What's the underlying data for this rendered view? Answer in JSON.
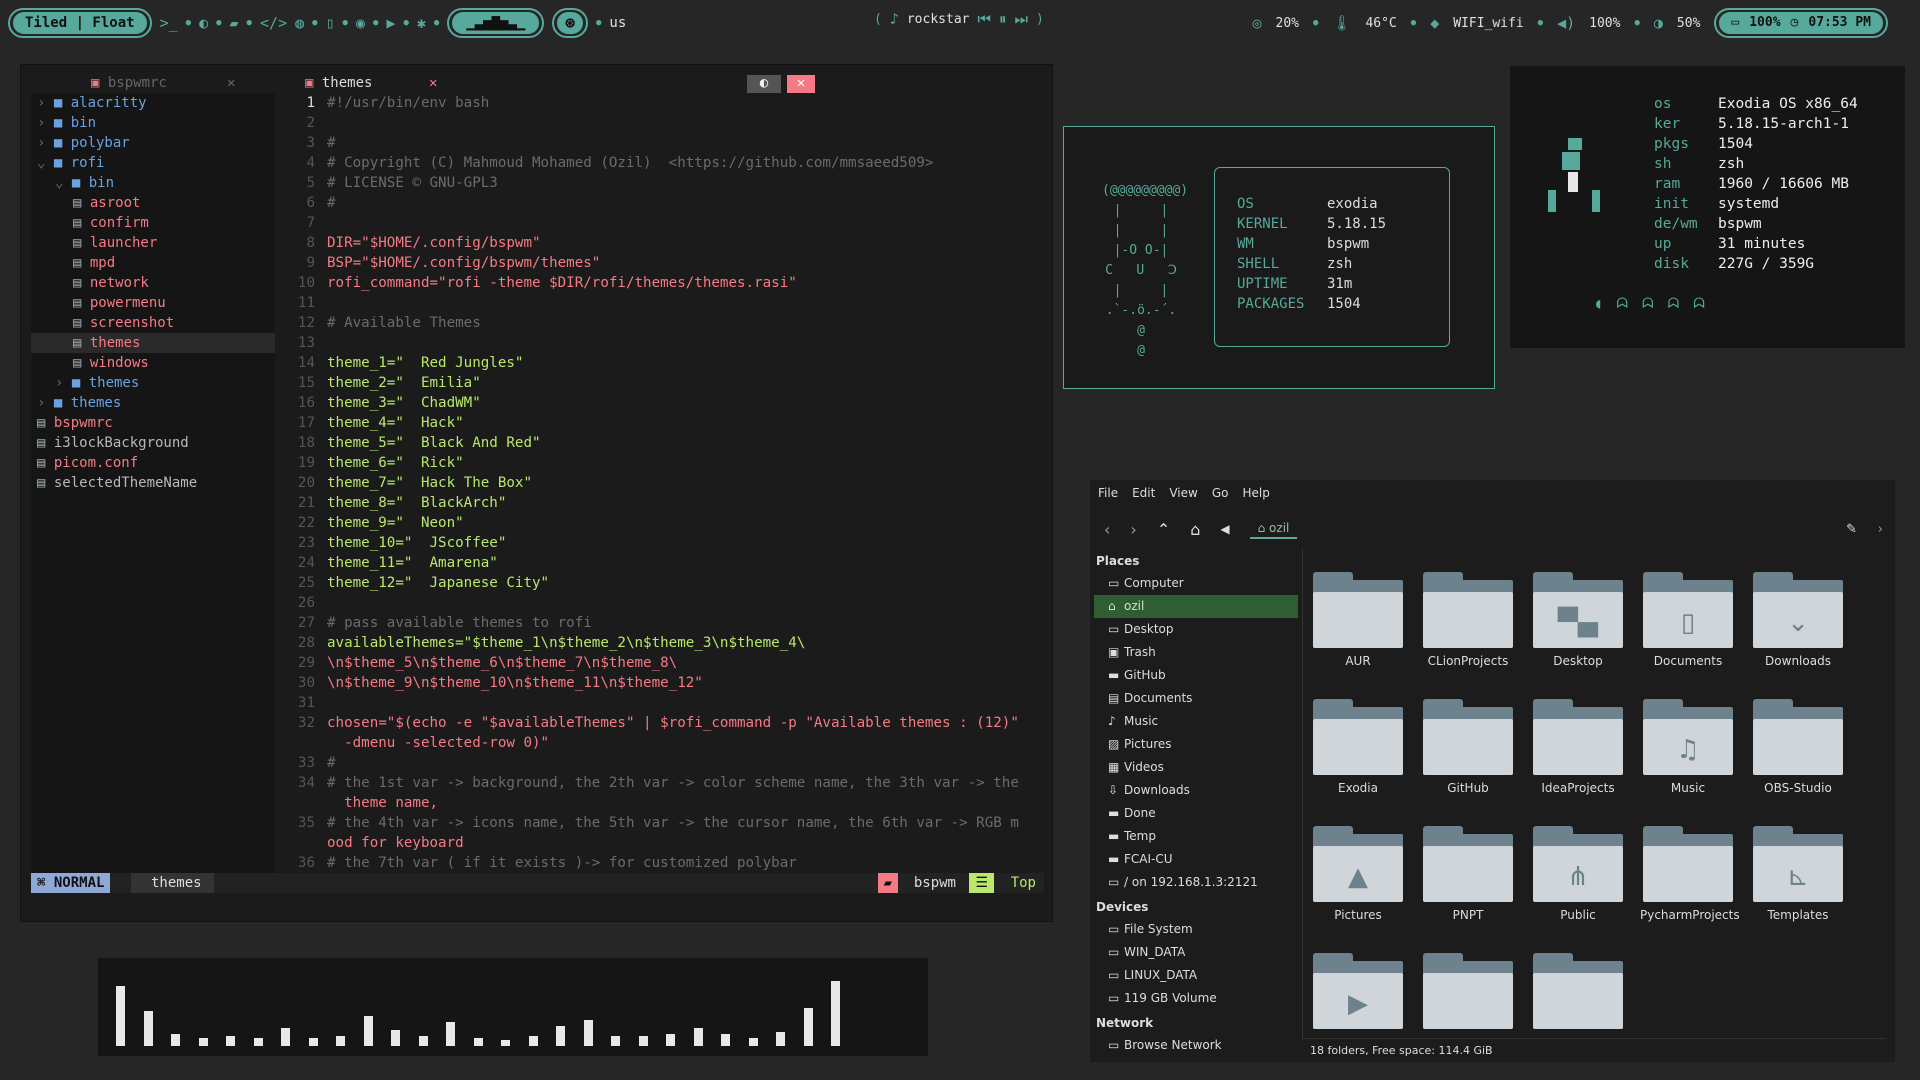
{
  "topbar": {
    "layout": "Tiled | Float",
    "keyboard": "us",
    "music": "rockstar",
    "cpu": "20%",
    "temp": "46°C",
    "wifi": "WIFI_wifi",
    "volume": "100%",
    "brightness": "50%",
    "battery": "100%",
    "time": "07:53 PM"
  },
  "colors": {
    "accent": "#57a99b",
    "bg": "#262626",
    "tab_close": "#f47b85"
  },
  "editor": {
    "tab_left": "bspwmrc",
    "tab_active": "themes",
    "tree": [
      "alacritty",
      "bin",
      "polybar",
      "rofi",
      "bin",
      "asroot",
      "confirm",
      "launcher",
      "mpd",
      "network",
      "powermenu",
      "screenshot",
      "themes",
      "windows",
      "themes",
      "themes",
      "bspwmrc",
      "i3lockBackground",
      "picom.conf",
      "selectedThemeName"
    ],
    "lines": [
      "#!/usr/bin/env bash",
      "",
      "#",
      "# Copyright (C) Mahmoud Mohamed (Ozil)  <https://github.com/mmsaeed509>",
      "# LICENSE © GNU-GPL3",
      "#",
      "",
      "DIR=\"$HOME/.config/bspwm\"",
      "BSP=\"$HOME/.config/bspwm/themes\"",
      "rofi_command=\"rofi -theme $DIR/rofi/themes/themes.rasi\"",
      "",
      "# Available Themes",
      "",
      "theme_1=\"  Red Jungles\"",
      "theme_2=\"  Emilia\"",
      "theme_3=\"  ChadWM\"",
      "theme_4=\"  Hack\"",
      "theme_5=\"  Black And Red\"",
      "theme_6=\"  Rick\"",
      "theme_7=\"  Hack The Box\"",
      "theme_8=\"  BlackArch\"",
      "theme_9=\"  Neon\"",
      "theme_10=\"  JScoffee\"",
      "theme_11=\"  Amarena\"",
      "theme_12=\"  Japanese City\"",
      "",
      "# pass available themes to rofi",
      "availableThemes=\"$theme_1\\n$theme_2\\n$theme_3\\n$theme_4\\",
      "\\n$theme_5\\n$theme_6\\n$theme_7\\n$theme_8\\",
      "\\n$theme_9\\n$theme_10\\n$theme_11\\n$theme_12\"",
      "",
      "chosen=\"$(echo -e \"$availableThemes\" | $rofi_command -p \"Available themes : (12)\"",
      "  -dmenu -selected-row 0)\"",
      "#",
      "# the 1st var -> background, the 2th var -> color scheme name, the 3th var -> the",
      "  theme name,",
      "# the 4th var -> icons name, the 5th var -> the cursor name, the 6th var -> RGB m",
      "ood for keyboard",
      "# the 7th var ( if it exists )-> for customized polybar"
    ],
    "line_numbers": [
      "1",
      "2",
      "3",
      "4",
      "5",
      "6",
      "7",
      "8",
      "9",
      "10",
      "11",
      "12",
      "13",
      "14",
      "15",
      "16",
      "17",
      "18",
      "19",
      "20",
      "21",
      "22",
      "23",
      "24",
      "25",
      "26",
      "27",
      "28",
      "29",
      "30",
      "31",
      "32",
      "",
      "33",
      "34",
      "",
      "35",
      "",
      "36"
    ],
    "mode": "NORMAL",
    "file": "themes",
    "session": "bspwm",
    "position": "Top"
  },
  "fetch": {
    "ascii": [
      "(@@@@@@@@@)",
      "|     |",
      "|     |",
      "|-O O-|",
      "C   U   Ↄ",
      "|     |",
      ".`-.ö.-´.",
      "@",
      "@"
    ],
    "keys": [
      "OS",
      "KERNEL",
      "WM",
      "SHELL",
      "UPTIME",
      "PACKAGES"
    ],
    "vals": [
      "exodia",
      "5.18.15",
      "bspwm",
      "zsh",
      "31m",
      "1504"
    ]
  },
  "sysinfo": {
    "keys": [
      "os",
      "ker",
      "pkgs",
      "sh",
      "ram",
      "init",
      "de/wm",
      "up",
      "disk"
    ],
    "vals": [
      "Exodia OS x86_64",
      "5.18.15-arch1-1",
      "1504",
      "zsh",
      "1960 / 16606 MB",
      "systemd",
      "bspwm",
      "31 minutes",
      "227G / 359G"
    ]
  },
  "filemanager": {
    "menu": [
      "File",
      "Edit",
      "View",
      "Go",
      "Help"
    ],
    "location": "ozil",
    "places_header": "Places",
    "places": [
      "Computer",
      "ozil",
      "Desktop",
      "Trash",
      "GitHub",
      "Documents",
      "Music",
      "Pictures",
      "Videos",
      "Downloads",
      "Done",
      "Temp",
      "FCAI-CU",
      "/ on 192.168.1.3:2121"
    ],
    "devices_header": "Devices",
    "devices": [
      "File System",
      "WIN_DATA",
      "LINUX_DATA",
      "119 GB Volume"
    ],
    "network_header": "Network",
    "network": [
      "Browse Network"
    ],
    "folders": [
      "AUR",
      "CLionProjects",
      "Desktop",
      "Documents",
      "Downloads",
      "Exodia",
      "GitHub",
      "IdeaProjects",
      "Music",
      "OBS-Studio",
      "Pictures",
      "PNPT",
      "Public",
      "PycharmProjects",
      "Templates",
      "",
      "",
      ""
    ],
    "status": "18 folders, Free space: 114.4 GiB"
  },
  "visualizer": [
    0.6,
    0.35,
    0.12,
    0.08,
    0.1,
    0.08,
    0.18,
    0.08,
    0.1,
    0.3,
    0.16,
    0.1,
    0.24,
    0.08,
    0.06,
    0.1,
    0.2,
    0.26,
    0.1,
    0.1,
    0.12,
    0.18,
    0.12,
    0.08,
    0.14,
    0.38,
    0.65
  ]
}
